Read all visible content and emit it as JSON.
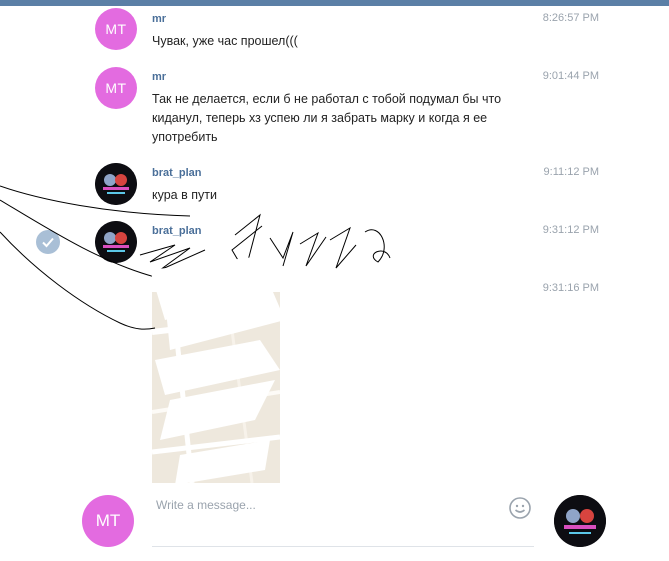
{
  "composer": {
    "avatar_initials": "MT",
    "placeholder": "Write a message..."
  },
  "messages": [
    {
      "author": "mr",
      "time": "8:26:57 PM",
      "avatar_initials": "MT",
      "text": "Чувак, уже час прошел((("
    },
    {
      "author": "mr",
      "time": "9:01:44 PM",
      "avatar_initials": "MT",
      "text": "Так не делается, если б не работал с тобой подумал бы что киданул, теперь хз успею ли я забрать марку и когда я ее употребить"
    },
    {
      "author": "brat_plan",
      "time": "9:11:12 PM",
      "text": "кура в пути"
    },
    {
      "author": "brat_plan",
      "time": "9:31:12 PM",
      "text": ""
    },
    {
      "time": "9:31:16 PM"
    }
  ],
  "colors": {
    "accent": "#5b7fa6",
    "author": "#4a6f99",
    "avatar_mt": "#e36be0",
    "check": "#a9bfd6"
  },
  "icons": [
    "check-icon",
    "smile-icon",
    "map-pin-icon"
  ]
}
